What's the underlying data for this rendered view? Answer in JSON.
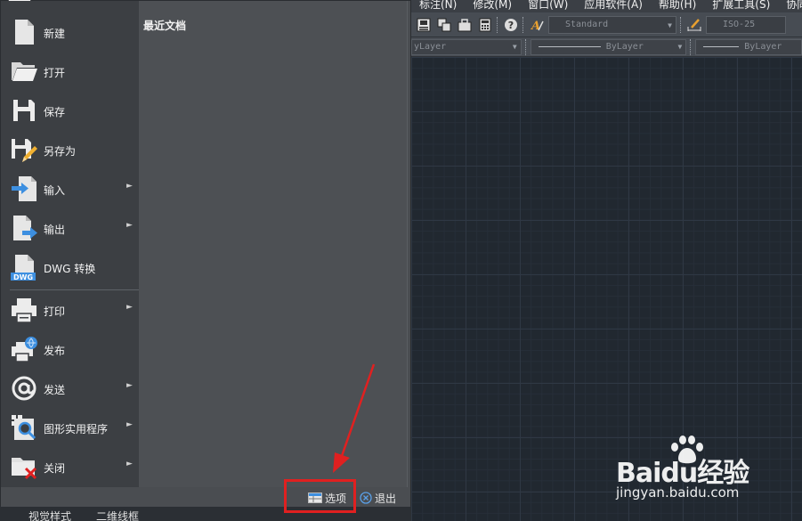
{
  "cad": {
    "menubar": [
      "标注(N)",
      "修改(M)",
      "窗口(W)",
      "应用软件(A)",
      "帮助(H)",
      "扩展工具(S)",
      "协同设计"
    ],
    "toolbar": {
      "text_style": "Standard",
      "dim_style": "ISO-25"
    },
    "properties": {
      "layer_combo": "yLayer",
      "linetype_combo": "ByLayer",
      "lineweight_combo": "ByLayer"
    }
  },
  "app_menu": {
    "items": [
      {
        "label": "新建",
        "icon": "new-file-icon",
        "submenu": false
      },
      {
        "label": "打开",
        "icon": "open-folder-icon",
        "submenu": false
      },
      {
        "label": "保存",
        "icon": "save-disk-icon",
        "submenu": false
      },
      {
        "label": "另存为",
        "icon": "save-as-icon",
        "submenu": false
      },
      {
        "label": "输入",
        "icon": "import-icon",
        "submenu": true
      },
      {
        "label": "输出",
        "icon": "export-icon",
        "submenu": true
      },
      {
        "label": "DWG 转换",
        "icon": "dwg-convert-icon",
        "submenu": false
      },
      {
        "label": "打印",
        "icon": "printer-icon",
        "submenu": true
      },
      {
        "label": "发布",
        "icon": "publish-icon",
        "submenu": false
      },
      {
        "label": "发送",
        "icon": "at-sign-icon",
        "submenu": true
      },
      {
        "label": "图形实用程序",
        "icon": "drawing-utilities-icon",
        "submenu": true
      },
      {
        "label": "关闭",
        "icon": "close-drawing-icon",
        "submenu": true
      }
    ],
    "recent_title": "最近文档",
    "options_label": "选项",
    "exit_label": "退出"
  },
  "bottom_strip": {
    "visual_style": "视觉样式",
    "wireframe": "二维线框"
  },
  "watermark": {
    "brand": "Baidu经验",
    "url": "jingyan.baidu.com"
  },
  "colors": {
    "annotation_red": "#e02020",
    "accent_blue": "#3d8fe0"
  }
}
